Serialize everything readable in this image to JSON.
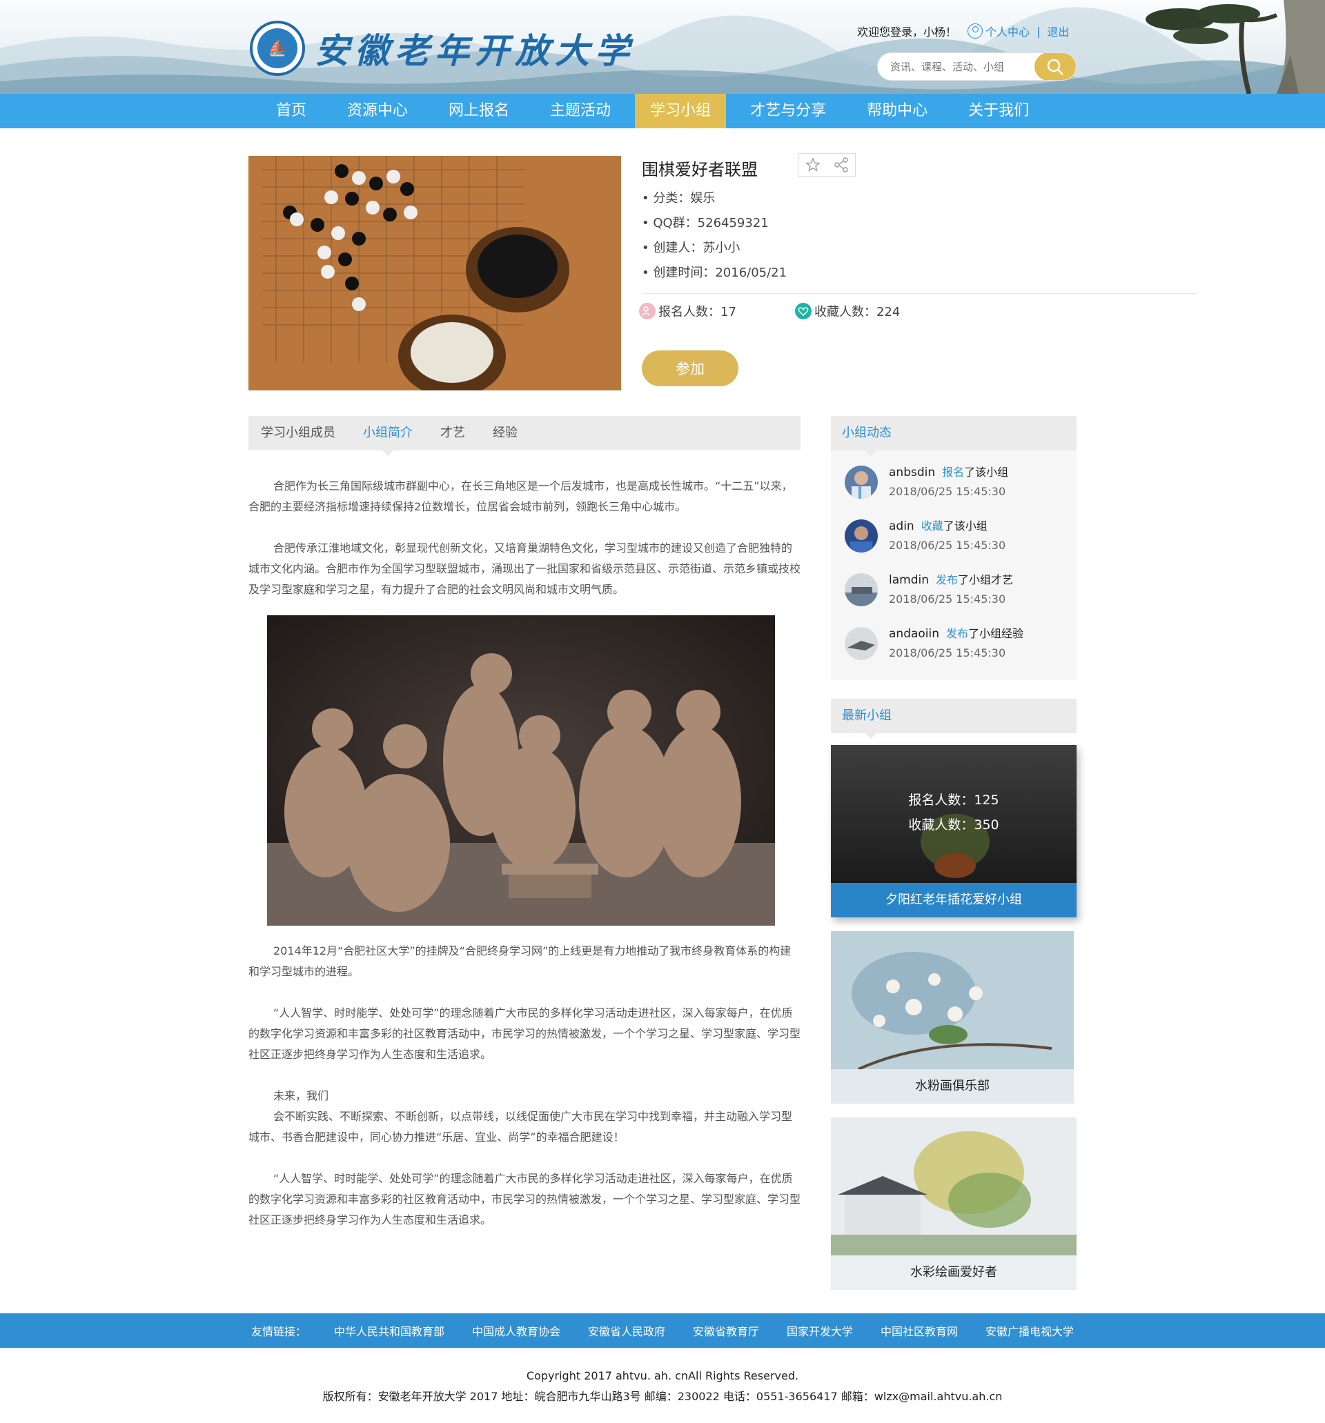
{
  "header": {
    "logo_text": "安徽老年开放大学",
    "welcome": "欢迎您登录，小杨！",
    "personal_center": "个人中心",
    "divider": "|",
    "logout": "退出",
    "search_placeholder": "资讯、课程、活动、小组"
  },
  "nav": {
    "items": [
      "首页",
      "资源中心",
      "网上报名",
      "主题活动",
      "学习小组",
      "才艺与分享",
      "帮助中心",
      "关于我们"
    ],
    "active": "学习小组"
  },
  "group": {
    "title": "围棋爱好者联盟",
    "category": "• 分类：娱乐",
    "qq": "• QQ群：526459321",
    "creator": "• 创建人：苏小小",
    "created": "• 创建时间：2016/05/21",
    "signups": "报名人数：17",
    "favorites": "收藏人数：224",
    "join": "参加"
  },
  "tabs": [
    "学习小组成员",
    "小组简介",
    "才艺",
    "经验"
  ],
  "active_tab": "小组简介",
  "article": {
    "p1": "合肥作为长三角国际级城市群副中心，在长三角地区是一个后发城市，也是高成长性城市。“十二五”以来，合肥的主要经济指标增速持续保持2位数增长，位居省会城市前列，领跑长三角中心城市。",
    "p2": "合肥传承江淮地域文化，彰显现代创新文化，又培育巢湖特色文化，学习型城市的建设又创造了合肥独特的城市文化内涵。合肥市作为全国学习型联盟城市，涌现出了一批国家和省级示范县区、示范街道、示范乡镇或技校及学习型家庭和学习之星，有力提升了合肥的社会文明风尚和城市文明气质。",
    "p3": "2014年12月“合肥社区大学”的挂牌及“合肥终身学习网”的上线更是有力地推动了我市终身教育体系的构建和学习型城市的进程。",
    "p4": "“人人智学、时时能学、处处可学”的理念随着广大市民的多样化学习活动走进社区，深入每家每户，在优质的数字化学习资源和丰富多彩的社区教育活动中，市民学习的热情被激发，一个个学习之星、学习型家庭、学习型社区正逐步把终身学习作为人生态度和生活追求。",
    "p5a": "未来，我们",
    "p5b": "会不断实践、不断探索、不断创新，以点带线，以线促面使广大市民在学习中找到幸福，并主动融入学习型城市、书香合肥建设中，同心协力推进“乐居、宜业、尚学”的幸福合肥建设！",
    "p6": "“人人智学、时时能学、处处可学”的理念随着广大市民的多样化学习活动走进社区，深入每家每户，在优质的数字化学习资源和丰富多彩的社区教育活动中，市民学习的热情被激发，一个个学习之星、学习型家庭、学习型社区正逐步把终身学习作为人生态度和生活追求。"
  },
  "sidebar": {
    "dynamics_title": "小组动态",
    "dynamics": [
      {
        "user": "anbsdin",
        "action": "报名",
        "rest": "了该小组",
        "time": "2018/06/25  15:45:30"
      },
      {
        "user": "adin",
        "action": "收藏",
        "rest": "了该小组",
        "time": "2018/06/25  15:45:30"
      },
      {
        "user": "lamdin",
        "action": "发布",
        "rest": "了小组才艺",
        "time": "2018/06/25  15:45:30"
      },
      {
        "user": "andaoiin",
        "action": "发布",
        "rest": "了小组经验",
        "time": "2018/06/25  15:45:30"
      }
    ],
    "newest_title": "最新小组",
    "cards": [
      {
        "name": "夕阳红老年插花爱好小组",
        "signups": "报名人数：125",
        "favorites": "收藏人数：350"
      },
      {
        "name": "水粉画俱乐部"
      },
      {
        "name": "水彩绘画爱好者"
      }
    ]
  },
  "footer": {
    "links_label": "友情链接：",
    "links": [
      "中华人民共和国教育部",
      "中国成人教育协会",
      "安徽省人民政府",
      "安徽省教育厅",
      "国家开发大学",
      "中国社区教育网",
      "安徽广播电视大学"
    ],
    "copyright": "Copyright 2017 ahtvu. ah. cnAll Rights Reserved.",
    "contact": "版权所有：安徽老年开放大学 2017 地址：皖合肥市九华山路3号 邮编：230022 电话：0551-3656417 邮箱：wlzx@mail.ahtvu.ah.cn"
  },
  "colors": {
    "nav_blue": "#3aa6ea",
    "gold": "#e2bd52",
    "link_blue": "#2a8fd6"
  }
}
